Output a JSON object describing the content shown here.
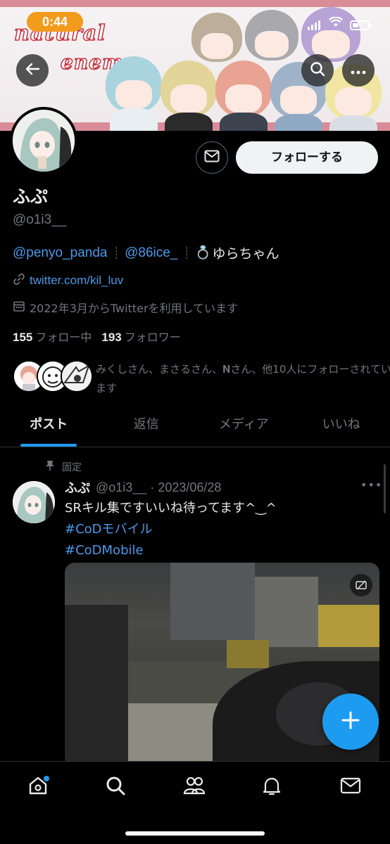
{
  "status_bar": {
    "time": "0:44"
  },
  "banner": {
    "title_line1": "natural",
    "title_line2": "enemy"
  },
  "profile": {
    "name": "ふぷ",
    "handle": "@o1i3__",
    "follow_button": "フォローする",
    "bio": {
      "mention1": "@penyo_panda",
      "separator": "┊",
      "mention2": "@86ice_",
      "ring_emoji": "💍",
      "tail": "ゆらちゃん"
    },
    "url": "twitter.com/kil_luv",
    "joined": "2022年3月からTwitterを利用しています",
    "following_count": "155",
    "following_label": "フォロー中",
    "followers_count": "193",
    "followers_label": "フォロワー",
    "followed_by": "みくしさん、まさるさん、𝐍さん、他10人にフォローされています"
  },
  "tabs": [
    {
      "label": "ポスト",
      "active": true
    },
    {
      "label": "返信",
      "active": false
    },
    {
      "label": "メディア",
      "active": false
    },
    {
      "label": "いいね",
      "active": false
    }
  ],
  "post": {
    "pinned_label": "固定",
    "author": "ふぷ",
    "meta": "@o1i3__ · 2023/06/28",
    "more": "•••",
    "text": "SRキル集ですいいね待ってます^‿^",
    "hashtag1": "#CoDモバイル",
    "hashtag2": "#CoDMobile"
  },
  "icons": {
    "back": "arrow-left-icon",
    "search": "search-icon",
    "more": "more-horizontal-icon",
    "mail": "mail-icon",
    "link": "link-icon",
    "calendar": "calendar-icon",
    "pin": "pin-icon",
    "fab": "plus-icon",
    "home": "home-icon",
    "explore": "search-icon",
    "communities": "people-icon",
    "notifications": "bell-icon",
    "messages": "envelope-icon"
  },
  "colors": {
    "accent": "#1d9bf0",
    "link": "#4a99e9",
    "text": "#e7e9ea",
    "muted": "#71767b",
    "time_pill": "#f29b1c",
    "follow_btn": "#eff3f4"
  }
}
